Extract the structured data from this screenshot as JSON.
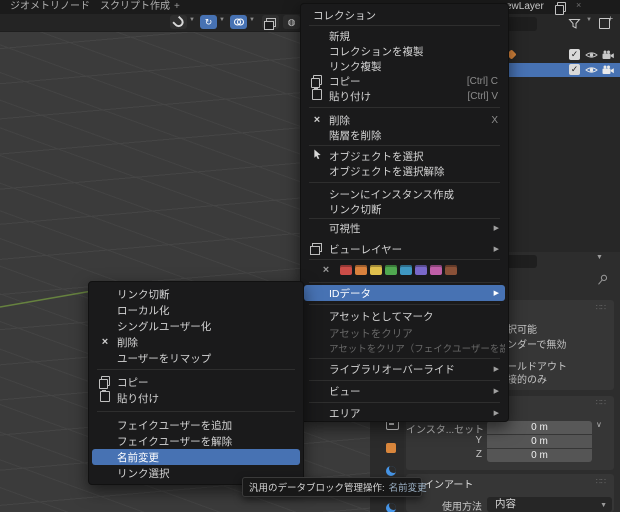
{
  "colors": {
    "accent": "#4772b3",
    "viewport_bg": "#3b3b3b",
    "menu_bg": "#1a1a1b",
    "axis_y_green": "#66823f"
  },
  "topbar": {
    "tabs": [
      "ジオメトリノード",
      "スクリプト作成"
    ],
    "new_tab": "+",
    "view_layer": "ewLayer"
  },
  "viewport_header": {
    "icons": [
      "snap-icon",
      "gizmo-icon",
      "overlays-icon",
      "xray-icon",
      "shading-icon"
    ]
  },
  "context_menu": {
    "title": "コレクション",
    "items": [
      {
        "label": "新規"
      },
      {
        "label": "コレクションを複製"
      },
      {
        "label": "リンク複製"
      },
      {
        "label": "コピー",
        "shortcut": "[Ctrl] C",
        "icon": "copy-icon"
      },
      {
        "label": "貼り付け",
        "shortcut": "[Ctrl] V",
        "icon": "paste-icon"
      },
      {
        "label": "削除",
        "shortcut": "X",
        "icon": "x-icon"
      },
      {
        "label": "階層を削除"
      },
      {
        "label": "オブジェクトを選択",
        "icon": "cursor-icon"
      },
      {
        "label": "オブジェクトを選択解除"
      },
      {
        "label": "シーンにインスタンス作成"
      },
      {
        "label": "リンク切断"
      },
      {
        "label": "可視性",
        "submenu": true
      },
      {
        "label": "ビューレイヤー",
        "submenu": true,
        "icon": "renderlayers-icon"
      },
      {
        "label": "IDデータ",
        "submenu": true,
        "highlighted": true
      },
      {
        "label": "アセットとしてマーク"
      },
      {
        "label": "アセットをクリア",
        "disabled": true
      },
      {
        "label": "アセットをクリア（フェイクユーザーを設定）",
        "disabled": true
      },
      {
        "label": "ライブラリオーバーライド",
        "submenu": true
      },
      {
        "label": "ビュー",
        "submenu": true
      },
      {
        "label": "エリア",
        "submenu": true
      }
    ],
    "color_row": {
      "clear": "×",
      "swatches": [
        "#cc4d48",
        "#d9813d",
        "#e0c04d",
        "#50a850",
        "#3f98c2",
        "#7a68c9",
        "#c05fa8",
        "#8a5138"
      ]
    }
  },
  "id_data_submenu": {
    "items": [
      {
        "label": "リンク切断"
      },
      {
        "label": "ローカル化"
      },
      {
        "label": "シングルユーザー化"
      },
      {
        "label": "削除",
        "icon": "x-icon"
      },
      {
        "label": "ユーザーをリマップ"
      },
      {
        "label": "コピー",
        "icon": "copy-icon"
      },
      {
        "label": "貼り付け",
        "icon": "paste-icon"
      },
      {
        "label": "フェイクユーザーを追加"
      },
      {
        "label": "フェイクユーザーを解除"
      },
      {
        "label": "名前変更",
        "highlighted": true
      },
      {
        "label": "リンク選択"
      }
    ]
  },
  "tooltip": {
    "text": "汎用のデータブロック管理操作:",
    "highlight": "名前変更"
  },
  "outliner": {
    "rows": 2
  },
  "properties": {
    "restrictions": {
      "labels": [
        "択可能",
        "ンダーで無効",
        "ールドアウト",
        "接的のみ"
      ]
    },
    "instance_offset": {
      "label_x": "インスタ...セット X",
      "label_y": "Y",
      "label_z": "Z",
      "value_x": "0 m",
      "value_y": "0 m",
      "value_z": "0 m"
    },
    "line_art": {
      "title": "ラインアート",
      "usage_label": "使用方法",
      "usage_value": "内容"
    }
  }
}
